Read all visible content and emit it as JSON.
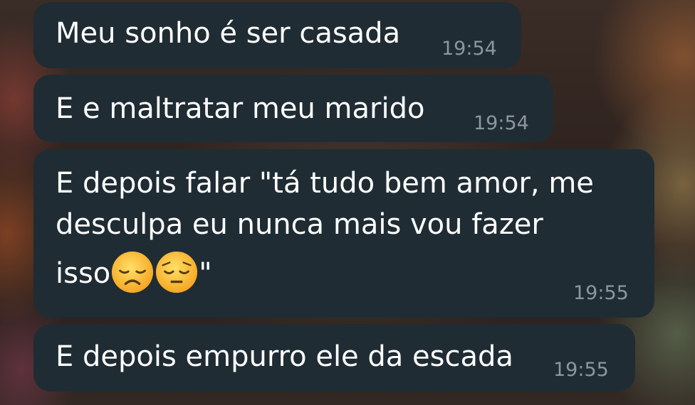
{
  "messages": [
    {
      "text": "Meu sonho é ser casada",
      "time": "19:54"
    },
    {
      "text": "E e maltratar meu marido",
      "time": "19:54"
    },
    {
      "lines": [
        "E depois falar \"tá tudo bem amor, me",
        "desculpa eu nunca mais vou fazer"
      ],
      "line3_prefix": "isso",
      "line3_suffix": "\"",
      "emojis": [
        "disappointed-face-icon",
        "pensive-face-icon"
      ],
      "time": "19:55"
    },
    {
      "text": "E depois empurro ele da escada",
      "time": "19:55"
    }
  ],
  "colors": {
    "bubble": "#1f2c33",
    "text": "#ffffff",
    "timestamp": "#8b979d"
  }
}
